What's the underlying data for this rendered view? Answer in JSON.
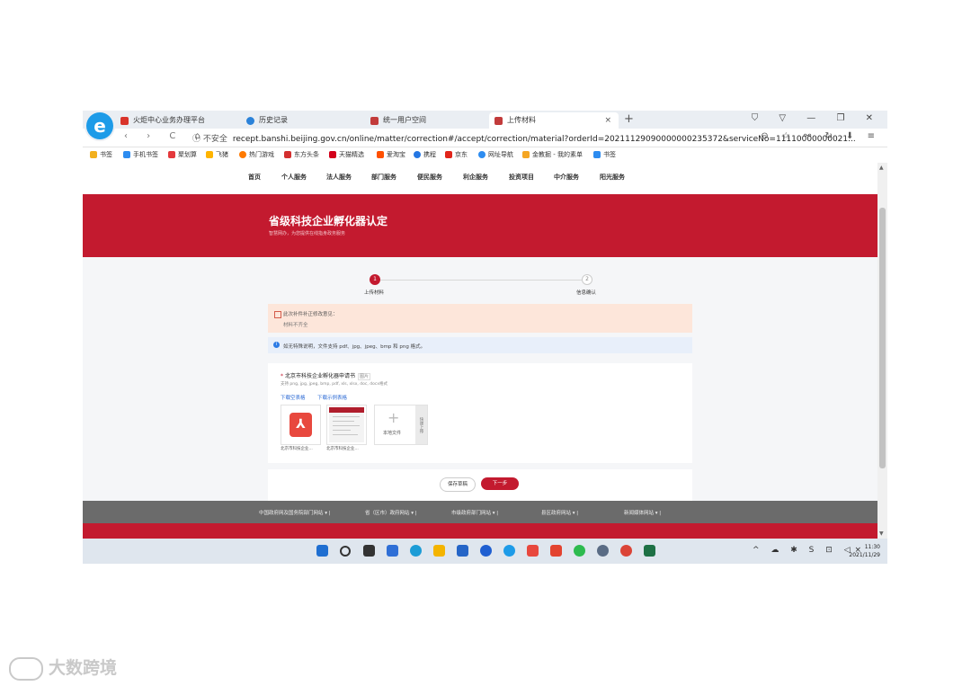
{
  "browser": {
    "logo": "e",
    "tabs": [
      {
        "label": "火炬中心业务办理平台",
        "color": "#d9342b"
      },
      {
        "label": "历史记录",
        "color": "#2b82d9"
      },
      {
        "label": "统一用户空间",
        "color": "#c23b3b"
      },
      {
        "label": "上传材料",
        "color": "#c23b3b",
        "close": "×"
      }
    ],
    "new_tab": "+",
    "window_controls": "⛉ ▽ — ❐ ✕",
    "nav_buttons": "‹ › C ⌂",
    "insecure": "ⓘ 不安全",
    "url": "recept.banshi.beijing.gov.cn/online/matter/correction#/accept/correction/material?orderId=20211129090000000235372&serviceNo=11110000000021...",
    "address_icons": "⊖ ☆ ⚯ ↻ ⬇ ≡",
    "bookmarks": [
      {
        "label": "书签",
        "color": "#f2b01e"
      },
      {
        "label": "手机书签",
        "color": "#2d8cf0"
      },
      {
        "label": "聚划算",
        "color": "#e4393c"
      },
      {
        "label": "飞猪",
        "color": "#ffb400"
      },
      {
        "label": "热门游戏",
        "color": "#ff7a00"
      },
      {
        "label": "东方头条",
        "color": "#d32f2f"
      },
      {
        "label": "天猫精选",
        "color": "#d3001b"
      },
      {
        "label": "爱淘宝",
        "color": "#ff5000"
      },
      {
        "label": "携程",
        "color": "#2577e3"
      },
      {
        "label": "京东",
        "color": "#e1251b"
      },
      {
        "label": "网址导航",
        "color": "#2d8cf0"
      },
      {
        "label": "金教掘 - 我的素单",
        "color": "#f5a623"
      },
      {
        "label": "书签",
        "color": "#2d8cf0"
      }
    ]
  },
  "site": {
    "nav": [
      "首页",
      "个人服务",
      "法人服务",
      "部门服务",
      "便民服务",
      "利企服务",
      "投资项目",
      "中介服务",
      "阳光服务"
    ],
    "banner_title": "省级科技企业孵化器认定",
    "banner_sub": "智慧网办，为您提供在线指身政务服务",
    "steps": [
      {
        "num": "1",
        "label": "上传材料"
      },
      {
        "num": "2",
        "label": "信息确认"
      }
    ],
    "notice_l1": "此次补件补正修改意见：",
    "notice_l2": "材料不齐全",
    "info_icon": "i",
    "info_text": "如无特殊说明，文件支持 pdf、jpg、jpeg、bmp 和 png 格式。",
    "material": {
      "star": "*",
      "title": "北京市科技企业孵化器申请书",
      "tag": "图片",
      "formats": "支持 png, jpg, jpeg, bmp, pdf, xls, xlsx, doc, docx格式",
      "link_template": "下载空表格",
      "link_sample": "下载示例表格",
      "pdf_glyph": "⅄",
      "upload_plus": "+",
      "upload_label": "本地文件",
      "upload_side": "快速上传",
      "file1": "北京市科技企业...",
      "file2": "北京市科技企业..."
    },
    "btn_save": "保存草稿",
    "btn_next": "下一步",
    "footer": [
      "中国政府网及国务院部门网站 ▾ |",
      "省（区市）政府网站 ▾ |",
      "市级政府部门网站 ▾ |",
      "县区政府网站 ▾ |",
      "新闻媒体网站 ▾ |"
    ]
  },
  "taskbar": {
    "icons": [
      {
        "name": "windows-start",
        "color": "#1f6fd1"
      },
      {
        "name": "search",
        "color": "#333333"
      },
      {
        "name": "task-view",
        "color": "#333333"
      },
      {
        "name": "widgets",
        "color": "#2f6fd6"
      },
      {
        "name": "edge",
        "color": "#1c9cd6"
      },
      {
        "name": "file-explorer",
        "color": "#f4b400"
      },
      {
        "name": "mail",
        "color": "#2565c7"
      },
      {
        "name": "app-blue",
        "color": "#1f5fd1"
      },
      {
        "name": "360-browser",
        "color": "#1d9be8"
      },
      {
        "name": "app-flag",
        "color": "#e8483e"
      },
      {
        "name": "app-red",
        "color": "#e3432f"
      },
      {
        "name": "wechat",
        "color": "#2dbb4f"
      },
      {
        "name": "settings",
        "color": "#5a6c85"
      },
      {
        "name": "chrome",
        "color": "#db4437"
      },
      {
        "name": "excel",
        "color": "#1e7145"
      }
    ],
    "tray": "^ ☁ ✱ S ⊡ ◁×",
    "time": "11:30",
    "date": "2021/11/29"
  },
  "watermark": "大数跨境"
}
